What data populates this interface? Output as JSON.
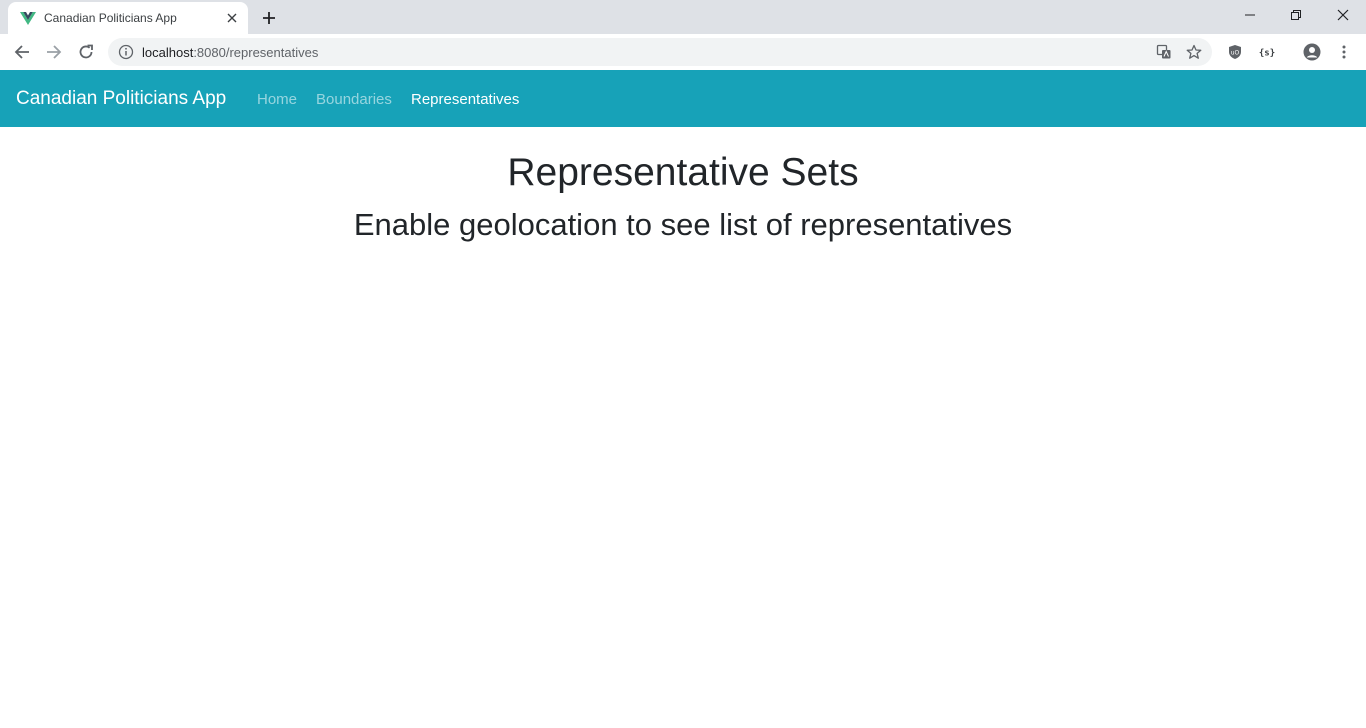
{
  "browser": {
    "tab": {
      "title": "Canadian Politicians App",
      "favicon": "vue-logo-icon"
    },
    "address_bar": {
      "host": "localhost",
      "rest": ":8080/representatives"
    },
    "icons": {
      "back": "back-arrow-icon",
      "forward": "forward-arrow-icon",
      "reload": "reload-icon",
      "info": "info-icon",
      "translate": "translate-icon",
      "bookmark": "star-icon",
      "extension1": "shield-extension-icon",
      "extension2": "braces-extension-icon",
      "profile": "profile-icon",
      "menu": "kebab-menu-icon"
    }
  },
  "navbar": {
    "brand": "Canadian Politicians App",
    "links": [
      {
        "label": "Home",
        "active": false
      },
      {
        "label": "Boundaries",
        "active": false
      },
      {
        "label": "Representatives",
        "active": true
      }
    ],
    "background_color": "#17a2b8"
  },
  "main": {
    "title": "Representative Sets",
    "subtitle": "Enable geolocation to see list of representatives"
  }
}
